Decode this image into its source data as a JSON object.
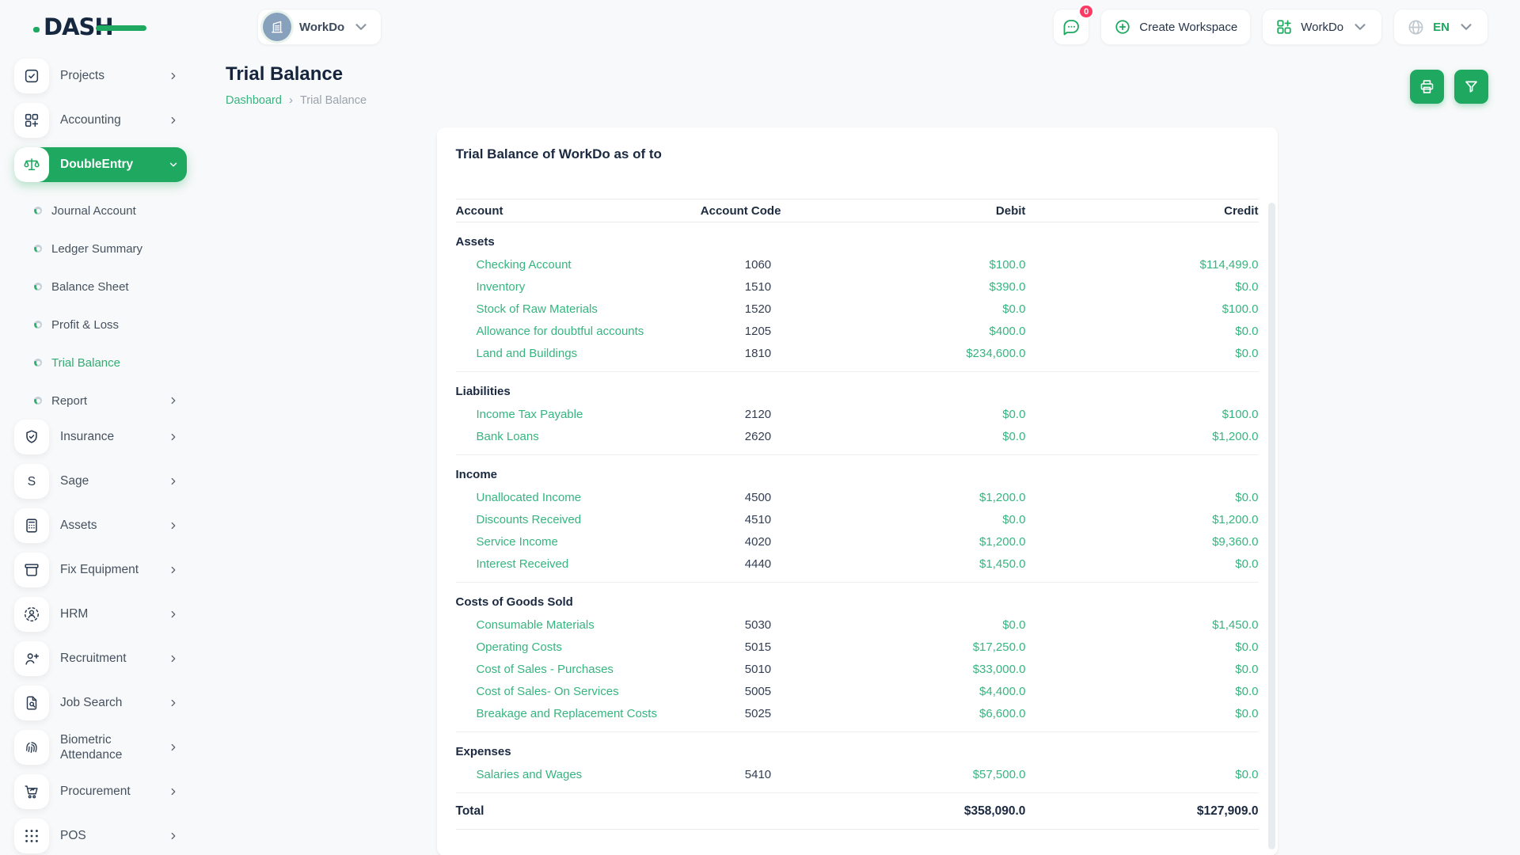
{
  "brand": {
    "logo_text": "DASH"
  },
  "header": {
    "workspace_name": "WorkDo",
    "messages_badge": "0",
    "create_workspace_label": "Create Workspace",
    "workspace_dropdown_label": "WorkDo",
    "language": "EN"
  },
  "sidebar": {
    "items": [
      {
        "type": "module",
        "label": "Projects",
        "icon": "projects-icon",
        "chevron": "right"
      },
      {
        "type": "module",
        "label": "Accounting",
        "icon": "accounting-icon",
        "chevron": "right"
      },
      {
        "type": "module",
        "label": "DoubleEntry",
        "icon": "double-entry-icon",
        "chevron": "down",
        "active": true
      },
      {
        "type": "sub",
        "label": "Journal Account"
      },
      {
        "type": "sub",
        "label": "Ledger Summary"
      },
      {
        "type": "sub",
        "label": "Balance Sheet"
      },
      {
        "type": "sub",
        "label": "Profit & Loss"
      },
      {
        "type": "sub",
        "label": "Trial Balance",
        "active": true
      },
      {
        "type": "sub",
        "label": "Report",
        "chevron": "right"
      },
      {
        "type": "module",
        "label": "Insurance",
        "icon": "insurance-icon",
        "chevron": "right"
      },
      {
        "type": "module",
        "label": "Sage",
        "icon": "sage-icon",
        "chevron": "right"
      },
      {
        "type": "module",
        "label": "Assets",
        "icon": "assets-icon",
        "chevron": "right"
      },
      {
        "type": "module",
        "label": "Fix Equipment",
        "icon": "fix-equipment-icon",
        "chevron": "right"
      },
      {
        "type": "module",
        "label": "HRM",
        "icon": "hrm-icon",
        "chevron": "right"
      },
      {
        "type": "module",
        "label": "Recruitment",
        "icon": "recruitment-icon",
        "chevron": "right"
      },
      {
        "type": "module",
        "label": "Job Search",
        "icon": "job-search-icon",
        "chevron": "right"
      },
      {
        "type": "module",
        "label": "Biometric Attendance",
        "icon": "biometric-attendance-icon",
        "chevron": "right"
      },
      {
        "type": "module",
        "label": "Procurement",
        "icon": "procurement-icon",
        "chevron": "right"
      },
      {
        "type": "module",
        "label": "POS",
        "icon": "pos-icon",
        "chevron": "right"
      }
    ]
  },
  "page": {
    "title": "Trial Balance",
    "breadcrumb": [
      "Dashboard",
      "Trial Balance"
    ]
  },
  "card": {
    "title": "Trial Balance of WorkDo as of to",
    "table": {
      "headers": [
        "Account",
        "Account Code",
        "Debit",
        "Credit"
      ],
      "sections": [
        {
          "name": "Assets",
          "rows": [
            [
              "Checking Account",
              "1060",
              "$100.0",
              "$114,499.0"
            ],
            [
              "Inventory",
              "1510",
              "$390.0",
              "$0.0"
            ],
            [
              "Stock of Raw Materials",
              "1520",
              "$0.0",
              "$100.0"
            ],
            [
              "Allowance for doubtful accounts",
              "1205",
              "$400.0",
              "$0.0"
            ],
            [
              "Land and Buildings",
              "1810",
              "$234,600.0",
              "$0.0"
            ]
          ]
        },
        {
          "name": "Liabilities",
          "rows": [
            [
              "Income Tax Payable",
              "2120",
              "$0.0",
              "$100.0"
            ],
            [
              "Bank Loans",
              "2620",
              "$0.0",
              "$1,200.0"
            ]
          ]
        },
        {
          "name": "Income",
          "rows": [
            [
              "Unallocated Income",
              "4500",
              "$1,200.0",
              "$0.0"
            ],
            [
              "Discounts Received",
              "4510",
              "$0.0",
              "$1,200.0"
            ],
            [
              "Service Income",
              "4020",
              "$1,200.0",
              "$9,360.0"
            ],
            [
              "Interest Received",
              "4440",
              "$1,450.0",
              "$0.0"
            ]
          ]
        },
        {
          "name": "Costs of Goods Sold",
          "rows": [
            [
              "Consumable Materials",
              "5030",
              "$0.0",
              "$1,450.0"
            ],
            [
              "Operating Costs",
              "5015",
              "$17,250.0",
              "$0.0"
            ],
            [
              "Cost of Sales - Purchases",
              "5010",
              "$33,000.0",
              "$0.0"
            ],
            [
              "Cost of Sales- On Services",
              "5005",
              "$4,400.0",
              "$0.0"
            ],
            [
              "Breakage and Replacement Costs",
              "5025",
              "$6,600.0",
              "$0.0"
            ]
          ]
        },
        {
          "name": "Expenses",
          "rows": [
            [
              "Salaries and Wages",
              "5410",
              "$57,500.0",
              "$0.0"
            ]
          ]
        }
      ],
      "total": {
        "label": "Total",
        "debit": "$358,090.0",
        "credit": "$127,909.0"
      }
    }
  },
  "colors": {
    "primary_green": "#1ea860",
    "link_green": "#35b57f",
    "badge_pink": "#fb3b64",
    "navy_text": "#1c2b3e"
  }
}
